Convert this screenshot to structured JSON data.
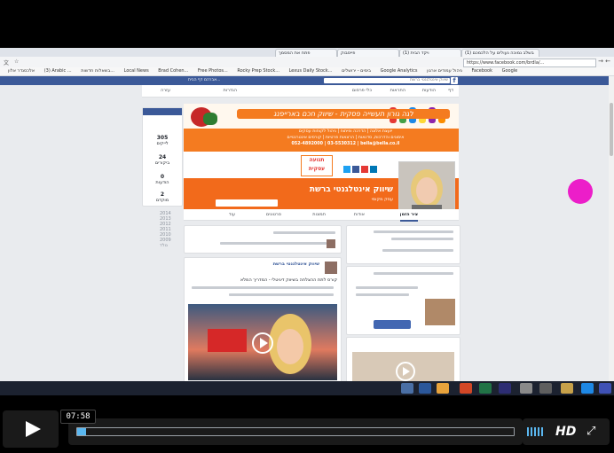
{
  "browser": {
    "url": "https://www.facebook.com/brdla/...",
    "tabs": [
      "(1) בשלב נמוכה נעולים על הלכמכם",
      "(1) ויקד הבית",
      "פייסבוק",
      "פתח את המסמך"
    ],
    "bookmarks": [
      "אלכסנדר אלון",
      "(3) Arabic ...",
      "בשאלות חדשות...",
      "Local News",
      "Brad Cohen...",
      "Free Photos...",
      "Rocky Prep Stock...",
      "Lexus Daily Stock...",
      "בימים - ירושלים",
      "Google Analytics",
      "ניהול עמודים ארגון",
      "Facebook",
      "Google"
    ]
  },
  "facebook": {
    "search_placeholder": "שיווק אינטלגנטי ברשת",
    "user": "אברהם...",
    "home": "דף הבית",
    "nav": [
      "דף",
      "הודעות",
      "התראות",
      "כלי פרסום",
      "הגדרות",
      "עזרה"
    ],
    "banner": {
      "title": "לגה גורון תעשייה פסקית - שיווק חכם בארייפנג",
      "lines": [
        "יועצת אלונה | הדרכה ופיתוח | ניהול לקוחות עסקים",
        "אימונים והדרכות, סדנאות | הרצאות פרטיות | קורסים אינטרנטיים",
        "052-4892000 | 03-5530312 | bella@bella.co.il"
      ]
    },
    "page_name": "שיווק אינטלגנטי ברשת",
    "page_category": "עסק מקומי",
    "brand_label": "תנועה עסקית",
    "tabs": [
      "ציר הזמן",
      "אודות",
      "תמונות",
      "סרטונים",
      "עוד"
    ],
    "sidebar_stats": [
      {
        "num": "305",
        "label": "לייקים"
      },
      {
        "num": "24",
        "label": "ביקורים"
      },
      {
        "num": "0",
        "label": "הודעות"
      },
      {
        "num": "2",
        "label": "מוקדם"
      }
    ],
    "years": [
      "2014",
      "2013",
      "2012",
      "2011",
      "2010",
      "2009",
      "נולד"
    ],
    "post_author": "שיווק אינטלגנטי ברשת",
    "post_text": "קורס לתת ההצלחה בשיווק דיגיטלי - המדריך המלא"
  },
  "player": {
    "time": "07:58",
    "progress": 0.02,
    "hd_label": "HD"
  },
  "colors": {
    "fb_blue": "#3b5998",
    "orange": "#f47b20",
    "cursor_magenta": "#ec1ec9"
  }
}
